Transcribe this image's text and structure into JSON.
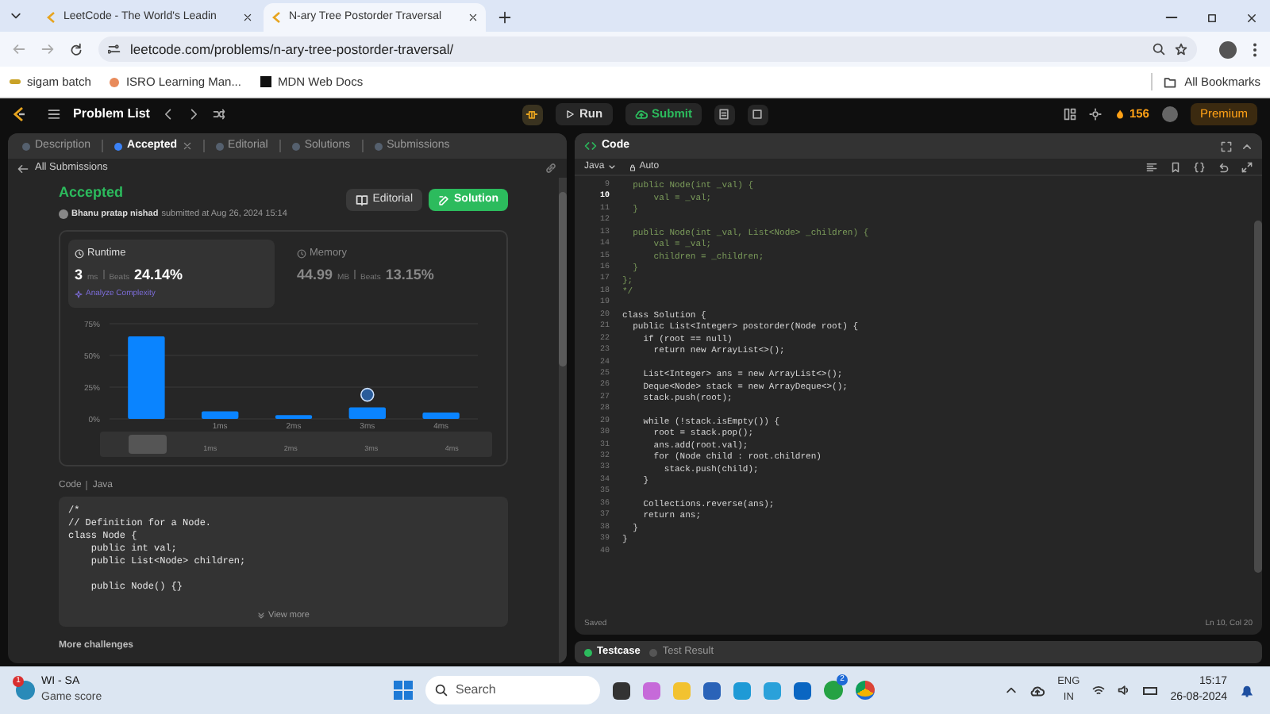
{
  "browser": {
    "tabs": [
      {
        "title": "LeetCode - The World's Leadin",
        "selected": false
      },
      {
        "title": "N-ary Tree Postorder Traversal",
        "selected": true
      }
    ],
    "address": "leetcode.com/problems/n-ary-tree-postorder-traversal/",
    "bookmarks": [
      "sigam batch",
      "ISRO Learning Man...",
      "MDN Web Docs"
    ],
    "all_bookmarks": "All Bookmarks"
  },
  "nav": {
    "problem_list": "Problem List",
    "run": "Run",
    "submit": "Submit",
    "streak": "156",
    "premium": "Premium"
  },
  "left_panel": {
    "tabs": [
      {
        "label": "Description",
        "selected": false,
        "closable": false
      },
      {
        "label": "Accepted",
        "selected": true,
        "closable": true
      },
      {
        "label": "Editorial",
        "selected": false,
        "closable": false
      },
      {
        "label": "Solutions",
        "selected": false,
        "closable": false
      },
      {
        "label": "Submissions",
        "selected": false,
        "closable": false
      }
    ],
    "back_link": "All Submissions",
    "status": "Accepted",
    "user": "Bhanu pratap nishad",
    "submitted": "submitted at Aug 26, 2024 15:14",
    "buttons": [
      "Editorial",
      "Solution"
    ],
    "runtime": {
      "label": "Runtime",
      "value": "3",
      "unit": "ms",
      "beats_label": "Beats",
      "beats": "24.14%",
      "link": "Analyze Complexity",
      "selected": true
    },
    "memory": {
      "label": "Memory",
      "value": "44.99",
      "unit": "MB",
      "beats_label": "Beats",
      "beats": "13.15%",
      "selected": false
    },
    "chart_data": {
      "type": "bar",
      "categories": [
        null,
        "1ms",
        "2ms",
        "3ms",
        "4ms"
      ],
      "values": [
        65,
        6,
        3,
        9,
        5
      ],
      "ylim": [
        0,
        75
      ],
      "yticks": [
        {
          "value": 0,
          "label": "0%"
        },
        {
          "value": 25,
          "label": "25%"
        },
        {
          "value": 50,
          "label": "50%"
        },
        {
          "value": 75,
          "label": "75%"
        }
      ]
    },
    "range_labels": [
      "1ms",
      "2ms",
      "3ms",
      "4ms"
    ],
    "code_label": "Code",
    "code_lang": "Java",
    "code_blocks": [
      [
        "/*",
        "// Definition for a Node.",
        "class Node {",
        "    public int val;",
        "    public List<Node> children;"
      ],
      [
        "    public Node() {}"
      ]
    ],
    "view_more": "View more",
    "more_challenges": "More challenges"
  },
  "editor": {
    "title": "Code",
    "language": "Java",
    "mode": "Auto",
    "lines": [
      {
        "number": "9",
        "text": "  public Node(int _val) {",
        "kind": "comment",
        "current": false
      },
      {
        "number": "10",
        "text": "      val = _val;",
        "kind": "comment",
        "current": true
      },
      {
        "number": "11",
        "text": "  }",
        "kind": "comment",
        "current": false
      },
      {
        "number": "12",
        "current": false
      },
      {
        "number": "13",
        "text": "  public Node(int _val, List<Node> _children) {",
        "kind": "comment",
        "current": false
      },
      {
        "number": "14",
        "text": "      val = _val;",
        "kind": "comment",
        "current": false
      },
      {
        "number": "15",
        "text": "      children = _children;",
        "kind": "comment",
        "current": false
      },
      {
        "number": "16",
        "text": "  }",
        "kind": "comment",
        "current": false
      },
      {
        "number": "17",
        "text": "};",
        "kind": "comment",
        "current": false
      },
      {
        "number": "18",
        "text": "*/",
        "kind": "comment",
        "current": false
      },
      {
        "number": "19",
        "current": false
      },
      {
        "number": "20",
        "text": "class Solution {",
        "kind": "code",
        "current": false
      },
      {
        "number": "21",
        "text": "  public List<Integer> postorder(Node root) {",
        "kind": "code",
        "current": false
      },
      {
        "number": "22",
        "text": "    if (root == null)",
        "kind": "code",
        "current": false
      },
      {
        "number": "23",
        "text": "      return new ArrayList<>();",
        "kind": "code",
        "current": false
      },
      {
        "number": "24",
        "current": false
      },
      {
        "number": "25",
        "text": "    List<Integer> ans = new ArrayList<>();",
        "kind": "code",
        "current": false
      },
      {
        "number": "26",
        "text": "    Deque<Node> stack = new ArrayDeque<>();",
        "kind": "code",
        "current": false
      },
      {
        "number": "27",
        "text": "    stack.push(root);",
        "kind": "code",
        "current": false
      },
      {
        "number": "28",
        "current": false
      },
      {
        "number": "29",
        "text": "    while (!stack.isEmpty()) {",
        "kind": "code",
        "current": false
      },
      {
        "number": "30",
        "text": "      root = stack.pop();",
        "kind": "code",
        "current": false
      },
      {
        "number": "31",
        "text": "      ans.add(root.val);",
        "kind": "code",
        "current": false
      },
      {
        "number": "32",
        "text": "      for (Node child : root.children)",
        "kind": "code",
        "current": false
      },
      {
        "number": "33",
        "text": "        stack.push(child);",
        "kind": "code",
        "current": false
      },
      {
        "number": "34",
        "text": "    }",
        "kind": "code",
        "current": false
      },
      {
        "number": "35",
        "current": false
      },
      {
        "number": "36",
        "text": "    Collections.reverse(ans);",
        "kind": "code",
        "current": false
      },
      {
        "number": "37",
        "text": "    return ans;",
        "kind": "code",
        "current": false
      },
      {
        "number": "38",
        "text": "  }",
        "kind": "code",
        "current": false
      },
      {
        "number": "39",
        "text": "}",
        "kind": "code",
        "current": false
      },
      {
        "number": "40",
        "current": false
      }
    ],
    "saved": "Saved",
    "cursor": "Ln 10, Col 20",
    "bottom_tabs": [
      {
        "label": "Testcase",
        "selected": true
      },
      {
        "label": "Test Result",
        "selected": false
      }
    ]
  },
  "taskbar": {
    "weather": {
      "title": "WI - SA",
      "subtitle": "Game score",
      "badge": "1"
    },
    "search": "Search",
    "whatsapp_badge": "2",
    "lang": "ENG",
    "region": "IN",
    "time": "15:17",
    "date": "26-08-2024"
  }
}
